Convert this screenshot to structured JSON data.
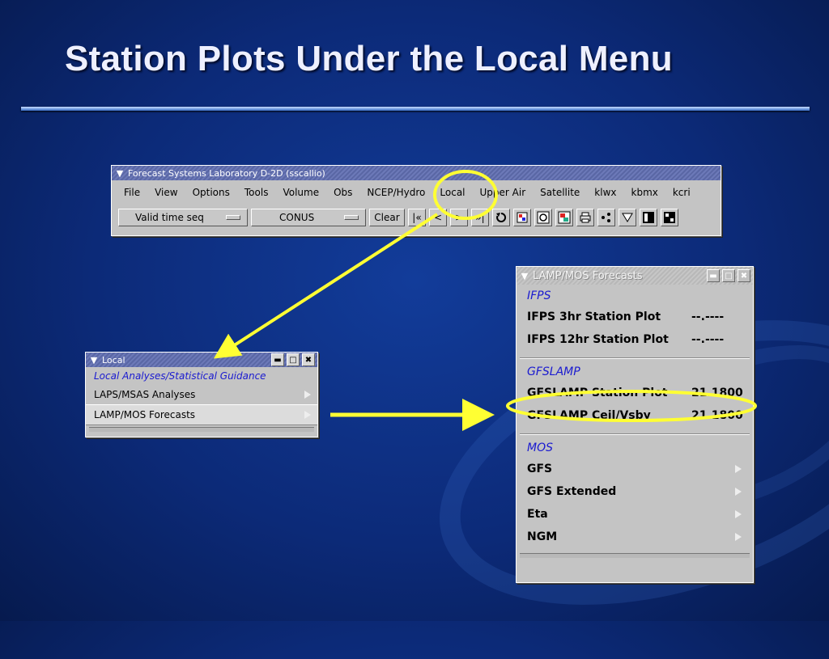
{
  "slide": {
    "title": "Station Plots Under the Local Menu"
  },
  "main_window": {
    "title": "Forecast Systems Laboratory D-2D (sscallio)",
    "menus": [
      "File",
      "View",
      "Options",
      "Tools",
      "Volume",
      "Obs",
      "NCEP/Hydro",
      "Local",
      "Upper Air",
      "Satellite",
      "klwx",
      "kbmx",
      "kcri"
    ],
    "time_option": "Valid time seq",
    "scale_option": "CONUS",
    "clear_label": "Clear",
    "nav_glyphs": [
      "|«",
      "<",
      ">",
      "»|"
    ]
  },
  "local_window": {
    "title": "Local",
    "header": "Local Analyses/Statistical Guidance",
    "items": [
      "LAPS/MSAS Analyses",
      "LAMP/MOS Forecasts"
    ]
  },
  "lamp_window": {
    "title": "LAMP/MOS Forecasts",
    "sections": [
      {
        "header": "IFPS",
        "items": [
          {
            "label": "IFPS 3hr Station Plot",
            "value": "--.----"
          },
          {
            "label": "IFPS 12hr Station Plot",
            "value": "--.----"
          }
        ]
      },
      {
        "header": "GFSLAMP",
        "items": [
          {
            "label": "GFSLAMP Station Plot",
            "value": "21.1800"
          },
          {
            "label": "GFSLAMP Ceil/Vsby",
            "value": "21.1800"
          }
        ]
      },
      {
        "header": "MOS",
        "items": [
          {
            "label": "GFS"
          },
          {
            "label": "GFS Extended"
          },
          {
            "label": "Eta"
          },
          {
            "label": "NGM"
          }
        ]
      }
    ]
  },
  "colors": {
    "highlight": "#ffff33",
    "header_blue": "#1a1ad0",
    "background": "#0c2a78"
  }
}
